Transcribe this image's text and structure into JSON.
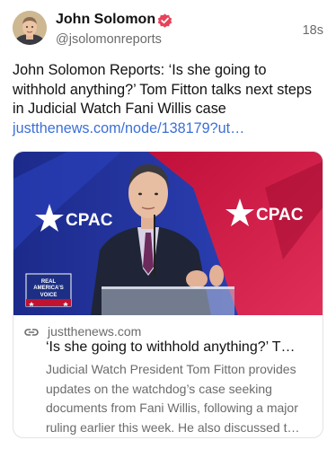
{
  "post": {
    "author_name": "John Solomon",
    "handle": "@jsolomonreports",
    "timestamp": "18s",
    "text": "John Solomon Reports: ‘Is she going to withhold anything?’ Tom Fitton talks next steps in Judicial Watch Fani Willis case",
    "link_text": "justthenews.com/node/138179?ut…"
  },
  "card": {
    "image_sign_left": "CPAC",
    "image_sign_right": "CPAC",
    "image_badge_top": "REAL",
    "image_badge_mid": "AMERICA'S",
    "image_badge_bottom": "VOICE",
    "domain": "justthenews.com",
    "title": "‘Is she going to withhold anything?’ T…",
    "description": "Judicial Watch President Tom Fitton provides updates on the watchdog’s case seeking documents from Fani Willis, following a major ruling earlier this week. He also discussed t…"
  },
  "colors": {
    "verified_badge": "#e8425a",
    "link": "#3b6fd9",
    "secondary_text": "#6b6b6b"
  },
  "icons": {
    "verified": "verified-badge-icon",
    "link": "link-chain-icon"
  }
}
